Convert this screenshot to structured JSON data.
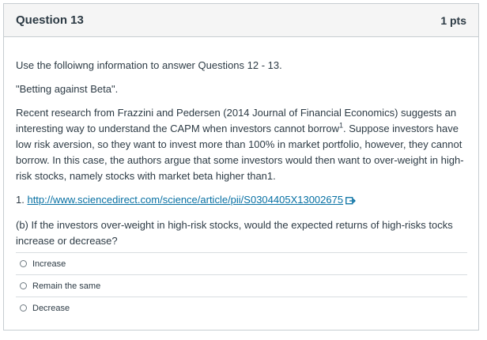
{
  "question": {
    "title": "Question 13",
    "points": "1 pts",
    "intro": "Use the folloiwng information to answer Questions 12 - 13.",
    "topic": "\"Betting against Beta\".",
    "paragraph_a": "Recent research from Frazzini and Pedersen (2014 Journal of Financial Economics) suggests an interesting way to understand the CAPM when investors cannot borrow",
    "footnote_mark": "1",
    "paragraph_b": ". Suppose investors have low risk aversion, so they want to invest more than 100% in market portfolio, however, they cannot borrow. In this case, the authors argue that some investors would then want to over-weight in high-risk stocks, namely stocks with market beta higher than1.",
    "footnote_prefix": "1. ",
    "footnote_link": "http://www.sciencedirect.com/science/article/pii/S0304405X13002675",
    "prompt": "(b) If the investors over-weight in high-risk stocks, would the expected returns of high-risks tocks increase or decrease?"
  },
  "answers": [
    {
      "label": "Increase"
    },
    {
      "label": "Remain the same"
    },
    {
      "label": "Decrease"
    }
  ],
  "colors": {
    "link": "#0770a3",
    "header_bg": "#f5f5f5",
    "border": "#c7cdd1"
  }
}
